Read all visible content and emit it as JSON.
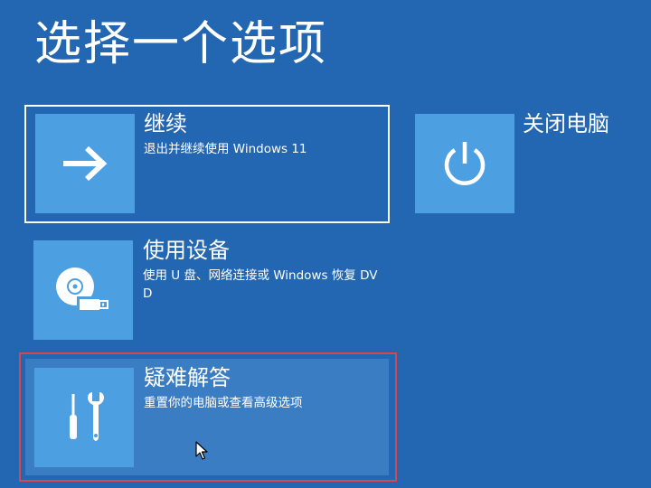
{
  "page": {
    "title": "选择一个选项"
  },
  "options": {
    "continue": {
      "title": "继续",
      "description": "退出并继续使用 Windows 11",
      "icon": "arrow-right-icon"
    },
    "use_device": {
      "title": "使用设备",
      "description": "使用 U 盘、网络连接或 Windows 恢复 DVD",
      "icon": "disc-usb-icon"
    },
    "troubleshoot": {
      "title": "疑难解答",
      "description": "重置你的电脑或查看高级选项",
      "icon": "tools-icon"
    },
    "shutdown": {
      "title": "关闭电脑",
      "icon": "power-icon"
    }
  },
  "colors": {
    "background": "#2367b2",
    "tile": "#4c9fe0",
    "hover": "#3b7dc2",
    "highlight_frame": "#d7474e",
    "focus_border": "#ffffff"
  }
}
